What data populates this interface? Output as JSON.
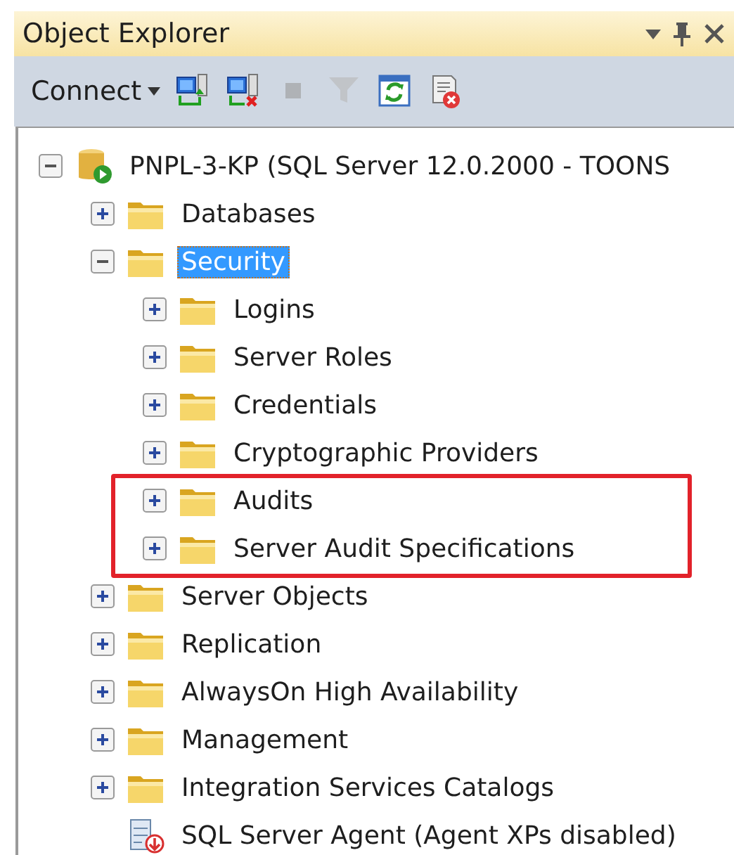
{
  "window": {
    "title": "Object Explorer"
  },
  "toolbar": {
    "connect": {
      "label": "Connect"
    },
    "tools": [
      {
        "kind": "connect",
        "disabled": false
      },
      {
        "kind": "disconnect",
        "disabled": false
      },
      {
        "kind": "stop",
        "disabled": true
      },
      {
        "kind": "filter",
        "disabled": true
      },
      {
        "kind": "refresh",
        "disabled": false
      },
      {
        "kind": "stop-script",
        "disabled": false
      }
    ]
  },
  "tree": [
    {
      "label": "PNPL-3-KP (SQL Server 12.0.2000 - TOONS",
      "kind": "server",
      "expanded": true,
      "selected": false,
      "children": [
        {
          "label": "Databases",
          "kind": "folder",
          "expanded": false,
          "selected": false
        },
        {
          "label": "Security",
          "kind": "folder",
          "expanded": true,
          "selected": true,
          "children": [
            {
              "label": "Logins",
              "kind": "folder",
              "expanded": false,
              "selected": false
            },
            {
              "label": "Server Roles",
              "kind": "folder",
              "expanded": false,
              "selected": false
            },
            {
              "label": "Credentials",
              "kind": "folder",
              "expanded": false,
              "selected": false
            },
            {
              "label": "Cryptographic Providers",
              "kind": "folder",
              "expanded": false,
              "selected": false
            },
            {
              "label": "Audits",
              "kind": "folder",
              "expanded": false,
              "selected": false,
              "highlighted": true
            },
            {
              "label": "Server Audit Specifications",
              "kind": "folder",
              "expanded": false,
              "selected": false,
              "highlighted": true
            }
          ]
        },
        {
          "label": "Server Objects",
          "kind": "folder",
          "expanded": false,
          "selected": false
        },
        {
          "label": "Replication",
          "kind": "folder",
          "expanded": false,
          "selected": false
        },
        {
          "label": "AlwaysOn High Availability",
          "kind": "folder",
          "expanded": false,
          "selected": false
        },
        {
          "label": "Management",
          "kind": "folder",
          "expanded": false,
          "selected": false
        },
        {
          "label": "Integration Services Catalogs",
          "kind": "folder",
          "expanded": false,
          "selected": false
        },
        {
          "label": "SQL Server Agent (Agent XPs disabled)",
          "kind": "agent",
          "selected": false
        }
      ]
    }
  ]
}
